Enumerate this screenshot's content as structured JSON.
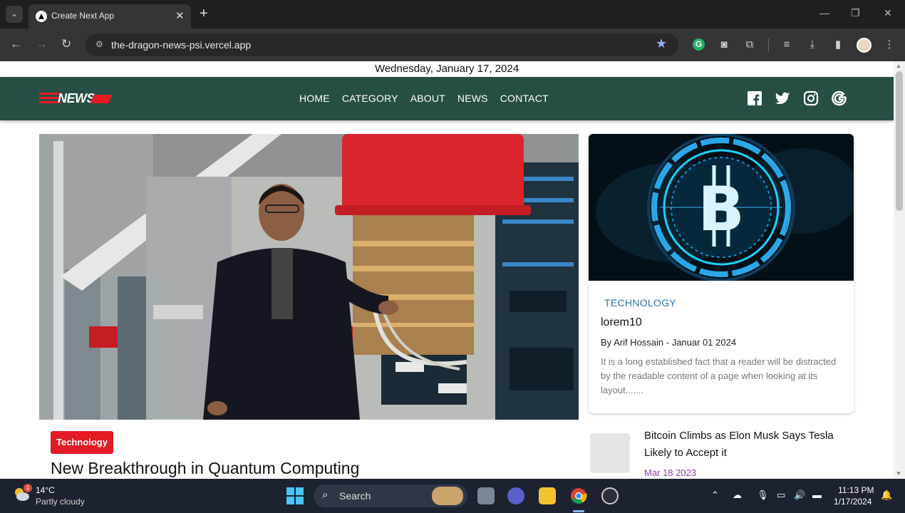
{
  "browser": {
    "tab_title": "Create Next App",
    "url": "the-dragon-news-psi.vercel.app"
  },
  "page": {
    "date_line": "Wednesday, January 17, 2024",
    "logo_text": "NEWS",
    "menu": [
      "HOME",
      "CATEGORY",
      "ABOUT",
      "NEWS",
      "CONTACT"
    ],
    "social_icons": [
      "facebook-icon",
      "twitter-icon",
      "instagram-icon",
      "google-icon"
    ],
    "hero": {
      "badge": "Technology",
      "title": "New Breakthrough in Quantum Computing"
    },
    "side_card": {
      "category": "TECHNOLOGY",
      "title": "lorem10",
      "author_line": "By Arif Hossain - Januar 01 2024",
      "excerpt": "It is a long established fact that a reader will be distracted by the readable content of a page when looking at its layout......."
    },
    "mini_item": {
      "title": "Bitcoin Climbs as Elon Musk Says Tesla Likely to Accept it",
      "date": "Mar 18 2023"
    }
  },
  "taskbar": {
    "temperature": "14°C",
    "condition": "Partly cloudy",
    "weather_badge": "1",
    "search_label": "Search",
    "time": "11:13 PM",
    "date": "1/17/2024"
  },
  "colors": {
    "nav_bg": "#274e46",
    "accent_red": "#e31b23",
    "category_blue": "#2b6fa8",
    "date_purple": "#8a3fa3"
  }
}
